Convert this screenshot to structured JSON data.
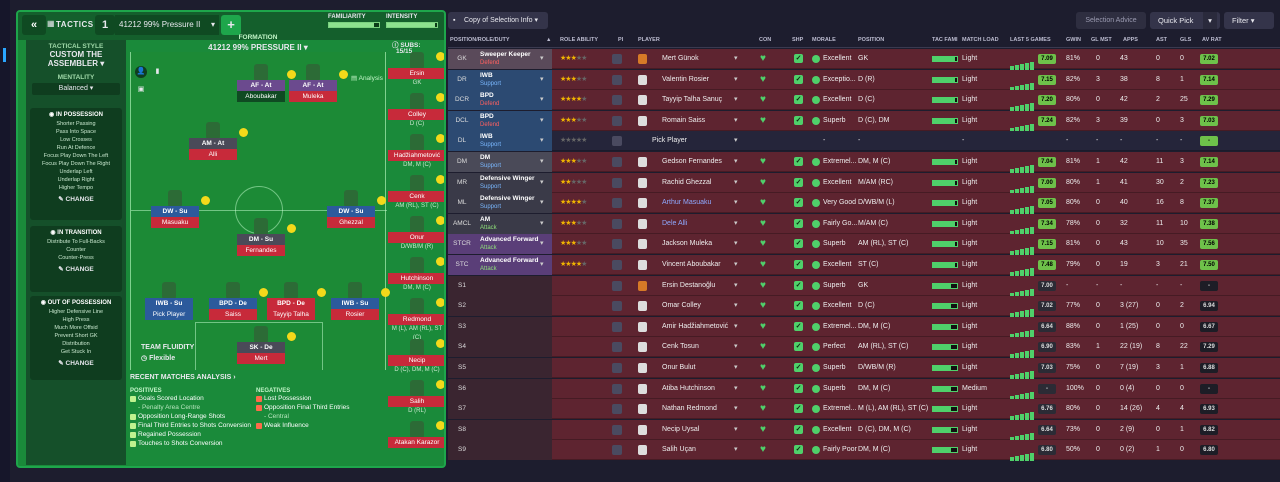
{
  "tactics": {
    "label": "TACTICS",
    "number": "1",
    "name": "41212 99% Pressure II",
    "familiarity_label": "FAMILIARITY",
    "intensity_label": "INTENSITY",
    "familiarity": 0.9,
    "intensity": 0.95
  },
  "style": {
    "header": "TACTICAL STYLE",
    "name": "CUSTOM THE ASSEMBLER",
    "mentality_label": "MENTALITY",
    "mentality": "Balanced"
  },
  "in_possession": {
    "header": "IN POSSESSION",
    "items": [
      "Shorter Passing",
      "Pass Into Space",
      "Low Crosses",
      "Run At Defence",
      "Focus Play Down The Left",
      "Focus Play Down The Right",
      "Underlap Left",
      "Underlap Right",
      "Higher Tempo"
    ],
    "change": "CHANGE"
  },
  "in_transition": {
    "header": "IN TRANSITION",
    "items": [
      "Distribute To Full-Backs",
      "Counter",
      "Counter-Press"
    ],
    "change": "CHANGE"
  },
  "out_possession": {
    "header": "OUT OF POSSESSION",
    "items": [
      "Higher Defensive Line",
      "High Press",
      "Much More Offsid",
      "Prevent Short GK",
      "Distribution",
      "Get Stuck In"
    ],
    "change": "CHANGE"
  },
  "formation": {
    "label": "FORMATION",
    "name": "41212 99% PRESSURE II",
    "subs_label": "SUBS:",
    "subs_count": "15/15",
    "analysis": "Analysis",
    "fluidity_label": "TEAM FLUIDITY",
    "fluidity": "Flexible"
  },
  "pitch_players": [
    {
      "role": "AF - At",
      "name": "Aboubakar"
    },
    {
      "role": "AF - At",
      "name": "Muleka"
    },
    {
      "role": "AM - At",
      "name": "Alli"
    },
    {
      "role": "DW - Su",
      "name": "Masuaku"
    },
    {
      "role": "DW - Su",
      "name": "Ghezzal"
    },
    {
      "role": "DM - Su",
      "name": "Fernandes"
    },
    {
      "role": "IWB - Su",
      "name": "Pick Player"
    },
    {
      "role": "BPD - De",
      "name": "Saiss"
    },
    {
      "role": "BPD - De",
      "name": "Tayyip Talha"
    },
    {
      "role": "IWB - Su",
      "name": "Rosier"
    },
    {
      "role": "SK - De",
      "name": "Mert"
    }
  ],
  "subs": [
    {
      "name": "Ersin",
      "pos": "GK"
    },
    {
      "name": "Colley",
      "pos": "D (C)"
    },
    {
      "name": "Hadžiahmetović",
      "pos": "DM, M (C)"
    },
    {
      "name": "Cenk",
      "pos": "AM (RL), ST (C)"
    },
    {
      "name": "Onur",
      "pos": "D/WB/M (R)"
    },
    {
      "name": "Hutchinson",
      "pos": "DM, M (C)"
    },
    {
      "name": "Redmond",
      "pos": "M (L), AM (RL), ST (C)"
    },
    {
      "name": "Necip",
      "pos": "D (C), DM, M (C)"
    },
    {
      "name": "Salih",
      "pos": "D (RL)"
    },
    {
      "name": "Atakan Karazor",
      "pos": ""
    }
  ],
  "rma": {
    "title": "RECENT MATCHES ANALYSIS",
    "positives_label": "POSITIVES",
    "negatives_label": "NEGATIVES",
    "positives": [
      {
        "text": "Goals Scored Location",
        "sub": "- Penalty Area Centre"
      },
      {
        "text": "Opposition Long-Range Shots",
        "sub": ""
      },
      {
        "text": "Final Third Entries to Shots Conversion",
        "sub": ""
      },
      {
        "text": "Regained Possession",
        "sub": ""
      },
      {
        "text": "Touches to Shots Conversion",
        "sub": ""
      }
    ],
    "negatives": [
      {
        "text": "Lost Possession",
        "sub": ""
      },
      {
        "text": "Opposition Final Third Entries",
        "sub": "- Central"
      },
      {
        "text": "Weak Influence",
        "sub": ""
      }
    ]
  },
  "toolbar": {
    "copy": "Copy of Selection Info",
    "selection_advice": "Selection Advice",
    "quick_pick": "Quick Pick",
    "filter": "Filter"
  },
  "columns": {
    "pos": "POSITION/ROLE/DUTY",
    "role_ability": "ROLE ABILITY",
    "pi": "PI",
    "player": "PLAYER",
    "con": "CON",
    "shp": "SHP",
    "morale": "MORALE",
    "position": "POSITION",
    "tac_fam": "TAC FAMI",
    "match_load": "MATCH LOAD",
    "last5": "LAST 5 GAMES",
    "gwin": "GWIN",
    "gl_mst": "GL MST",
    "apps": "APPS",
    "ast": "AST",
    "gls": "GLS",
    "av_rat": "AV RAT"
  },
  "rows": [
    {
      "slot": "GK",
      "role": "Sweeper Keeper",
      "duty": "Defend",
      "stars": 3,
      "name": "Mert Günok",
      "morale": "Excellent",
      "position": "GK",
      "load": "Light",
      "rating": "7.09",
      "gwin": "81%",
      "gl": "0",
      "apps": "43",
      "ast": "0",
      "gls": "0",
      "avr": "7.02"
    },
    {
      "slot": "DR",
      "role": "IWB",
      "duty": "Support",
      "stars": 3,
      "name": "Valentin Rosier",
      "morale": "Exceptio...",
      "position": "D (R)",
      "load": "Light",
      "rating": "7.15",
      "gwin": "82%",
      "gl": "3",
      "apps": "38",
      "ast": "8",
      "gls": "1",
      "avr": "7.14"
    },
    {
      "slot": "DCR",
      "role": "BPD",
      "duty": "Defend",
      "stars": 4,
      "name": "Tayyip Talha Sanuç",
      "morale": "Excellent",
      "position": "D (C)",
      "load": "Light",
      "rating": "7.20",
      "gwin": "80%",
      "gl": "0",
      "apps": "42",
      "ast": "2",
      "gls": "25",
      "avr": "7.29"
    },
    {
      "slot": "DCL",
      "role": "BPD",
      "duty": "Defend",
      "stars": 3,
      "name": "Romain Saiss",
      "morale": "Superb",
      "position": "D (C), DM",
      "load": "Light",
      "rating": "7.24",
      "gwin": "82%",
      "gl": "3",
      "apps": "39",
      "ast": "0",
      "gls": "3",
      "avr": "7.03"
    },
    {
      "slot": "DL",
      "role": "IWB",
      "duty": "Support",
      "stars": 0,
      "name": "Pick Player",
      "morale": "-",
      "position": "-",
      "load": "-",
      "rating": "",
      "gwin": "-",
      "gl": "-",
      "apps": "-",
      "ast": "-",
      "gls": "-",
      "avr": "-"
    },
    {
      "slot": "DM",
      "role": "DM",
      "duty": "Support",
      "stars": 3,
      "name": "Gedson Fernandes",
      "morale": "Extremel...",
      "position": "DM, M (C)",
      "load": "Light",
      "rating": "7.04",
      "gwin": "81%",
      "gl": "1",
      "apps": "42",
      "ast": "11",
      "gls": "3",
      "avr": "7.14"
    },
    {
      "slot": "MR",
      "role": "Defensive Winger",
      "duty": "Support",
      "stars": 2,
      "name": "Rachid Ghezzal",
      "morale": "Excellent",
      "position": "M/AM (RC)",
      "load": "Light",
      "rating": "7.00",
      "gwin": "80%",
      "gl": "1",
      "apps": "41",
      "ast": "30",
      "gls": "2",
      "avr": "7.23"
    },
    {
      "slot": "ML",
      "role": "Defensive Winger",
      "duty": "Support",
      "stars": 4,
      "name": "Arthur Masuaku",
      "morale": "Very Good",
      "position": "D/WB/M (L)",
      "load": "Light",
      "rating": "7.05",
      "gwin": "80%",
      "gl": "0",
      "apps": "40",
      "ast": "16",
      "gls": "8",
      "avr": "7.37"
    },
    {
      "slot": "AMCL",
      "role": "AM",
      "duty": "Attack",
      "stars": 3,
      "name": "Dele Alli",
      "morale": "Fairly Go...",
      "position": "M/AM (C)",
      "load": "Light",
      "rating": "7.34",
      "gwin": "78%",
      "gl": "0",
      "apps": "32",
      "ast": "11",
      "gls": "10",
      "avr": "7.38"
    },
    {
      "slot": "STCR",
      "role": "Advanced Forward",
      "duty": "Attack",
      "stars": 3,
      "name": "Jackson Muleka",
      "morale": "Superb",
      "position": "AM (RL), ST (C)",
      "load": "Light",
      "rating": "7.15",
      "gwin": "81%",
      "gl": "0",
      "apps": "43",
      "ast": "10",
      "gls": "35",
      "avr": "7.56"
    },
    {
      "slot": "STC",
      "role": "Advanced Forward",
      "duty": "Attack",
      "stars": 4,
      "name": "Vincent Aboubakar",
      "morale": "Excellent",
      "position": "ST (C)",
      "load": "Light",
      "rating": "7.48",
      "gwin": "79%",
      "gl": "0",
      "apps": "19",
      "ast": "3",
      "gls": "21",
      "avr": "7.50"
    },
    {
      "slot": "S1",
      "role": "",
      "duty": "",
      "stars": 0,
      "name": "Ersin Destanoğlu",
      "morale": "Superb",
      "position": "GK",
      "load": "Light",
      "rating": "7.00",
      "gwin": "-",
      "gl": "-",
      "apps": "-",
      "ast": "-",
      "gls": "-",
      "avr": "-"
    },
    {
      "slot": "S2",
      "role": "",
      "duty": "",
      "stars": 0,
      "name": "Omar Colley",
      "morale": "Excellent",
      "position": "D (C)",
      "load": "Light",
      "rating": "7.02",
      "gwin": "77%",
      "gl": "0",
      "apps": "3 (27)",
      "ast": "0",
      "gls": "2",
      "avr": "6.94"
    },
    {
      "slot": "S3",
      "role": "",
      "duty": "",
      "stars": 0,
      "name": "Amir Hadžiahmetović",
      "morale": "Extremel...",
      "position": "DM, M (C)",
      "load": "Light",
      "rating": "6.64",
      "gwin": "88%",
      "gl": "0",
      "apps": "1 (25)",
      "ast": "0",
      "gls": "0",
      "avr": "6.67"
    },
    {
      "slot": "S4",
      "role": "",
      "duty": "",
      "stars": 0,
      "name": "Cenk Tosun",
      "morale": "Perfect",
      "position": "AM (RL), ST (C)",
      "load": "Light",
      "rating": "6.90",
      "gwin": "83%",
      "gl": "1",
      "apps": "22 (19)",
      "ast": "8",
      "gls": "22",
      "avr": "7.29"
    },
    {
      "slot": "S5",
      "role": "",
      "duty": "",
      "stars": 0,
      "name": "Onur Bulut",
      "morale": "Superb",
      "position": "D/WB/M (R)",
      "load": "Light",
      "rating": "7.03",
      "gwin": "75%",
      "gl": "0",
      "apps": "7 (19)",
      "ast": "3",
      "gls": "1",
      "avr": "6.88"
    },
    {
      "slot": "S6",
      "role": "",
      "duty": "",
      "stars": 0,
      "name": "Atiba Hutchinson",
      "morale": "Superb",
      "position": "DM, M (C)",
      "load": "Medium",
      "rating": "-",
      "gwin": "100%",
      "gl": "0",
      "apps": "0 (4)",
      "ast": "0",
      "gls": "0",
      "avr": "-"
    },
    {
      "slot": "S7",
      "role": "",
      "duty": "",
      "stars": 0,
      "name": "Nathan Redmond",
      "morale": "Extremel...",
      "position": "M (L), AM (RL), ST (C)",
      "load": "Light",
      "rating": "6.76",
      "gwin": "80%",
      "gl": "0",
      "apps": "14 (26)",
      "ast": "4",
      "gls": "4",
      "avr": "6.93"
    },
    {
      "slot": "S8",
      "role": "",
      "duty": "",
      "stars": 0,
      "name": "Necip Uysal",
      "morale": "Excellent",
      "position": "D (C), DM, M (C)",
      "load": "Light",
      "rating": "6.64",
      "gwin": "73%",
      "gl": "0",
      "apps": "2 (9)",
      "ast": "0",
      "gls": "1",
      "avr": "6.82"
    },
    {
      "slot": "S9",
      "role": "",
      "duty": "",
      "stars": 0,
      "name": "Salih Uçan",
      "morale": "Fairly Poor",
      "position": "DM, M (C)",
      "load": "Light",
      "rating": "6.80",
      "gwin": "50%",
      "gl": "0",
      "apps": "0 (2)",
      "ast": "1",
      "gls": "0",
      "avr": "6.80"
    }
  ]
}
